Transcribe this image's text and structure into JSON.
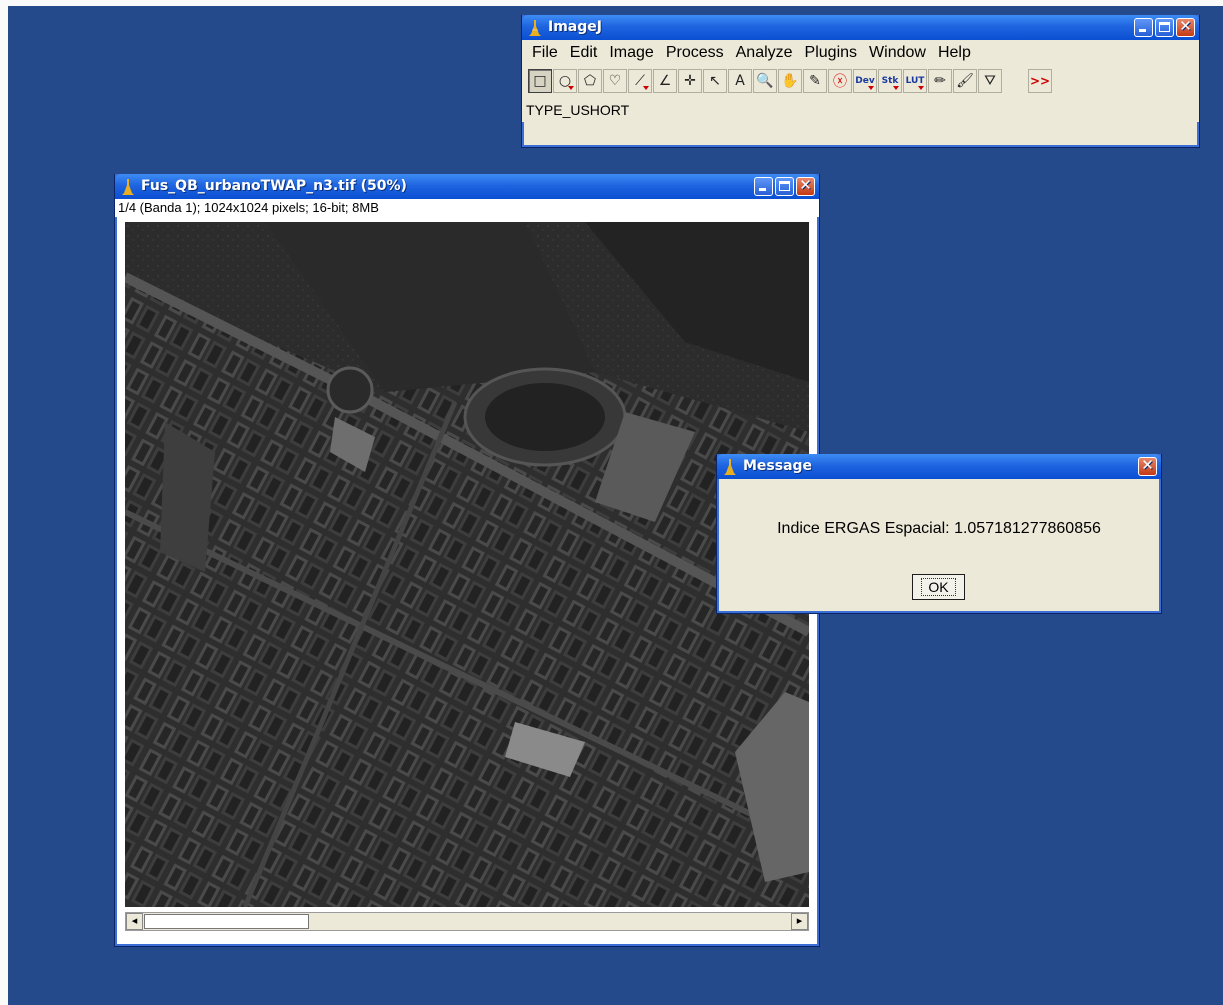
{
  "imagej": {
    "title": "ImageJ",
    "menu": [
      "File",
      "Edit",
      "Image",
      "Process",
      "Analyze",
      "Plugins",
      "Window",
      "Help"
    ],
    "tools": [
      {
        "name": "rectangle-tool-icon",
        "glyph": "□"
      },
      {
        "name": "oval-tool-icon",
        "glyph": "○"
      },
      {
        "name": "polygon-tool-icon",
        "glyph": "⬠"
      },
      {
        "name": "freehand-tool-icon",
        "glyph": "♡"
      },
      {
        "name": "line-tool-icon",
        "glyph": "⟋"
      },
      {
        "name": "angle-tool-icon",
        "glyph": "∠"
      },
      {
        "name": "point-tool-icon",
        "glyph": "✛"
      },
      {
        "name": "wand-tool-icon",
        "glyph": "↖"
      },
      {
        "name": "text-tool-icon",
        "glyph": "A"
      },
      {
        "name": "magnifier-tool-icon",
        "glyph": "🔍"
      },
      {
        "name": "hand-tool-icon",
        "glyph": "✋"
      },
      {
        "name": "dropper-tool-icon",
        "glyph": "✎"
      },
      {
        "name": "stop-tool-icon",
        "glyph": "ⓧ"
      },
      {
        "name": "dev-tool-icon",
        "glyph": "Dev"
      },
      {
        "name": "stk-tool-icon",
        "glyph": "Stk"
      },
      {
        "name": "lut-tool-icon",
        "glyph": "LUT"
      },
      {
        "name": "pencil-tool-icon",
        "glyph": "✏"
      },
      {
        "name": "brush-tool-icon",
        "glyph": "🖌"
      },
      {
        "name": "flood-fill-tool-icon",
        "glyph": "⛛"
      }
    ],
    "more_tools": ">>",
    "status": "TYPE_USHORT"
  },
  "image_window": {
    "title": "Fus_QB_urbanoTWAP_n3.tif (50%)",
    "info": "1/4 (Banda 1); 1024x1024 pixels; 16-bit; 8MB"
  },
  "message": {
    "title": "Message",
    "text": "Indice ERGAS Espacial: 1.057181277860856",
    "ok_label": "OK"
  },
  "colors": {
    "desktop": "#254a8c",
    "titlebar": "#0a4fd2",
    "window_face": "#ece9d8"
  }
}
